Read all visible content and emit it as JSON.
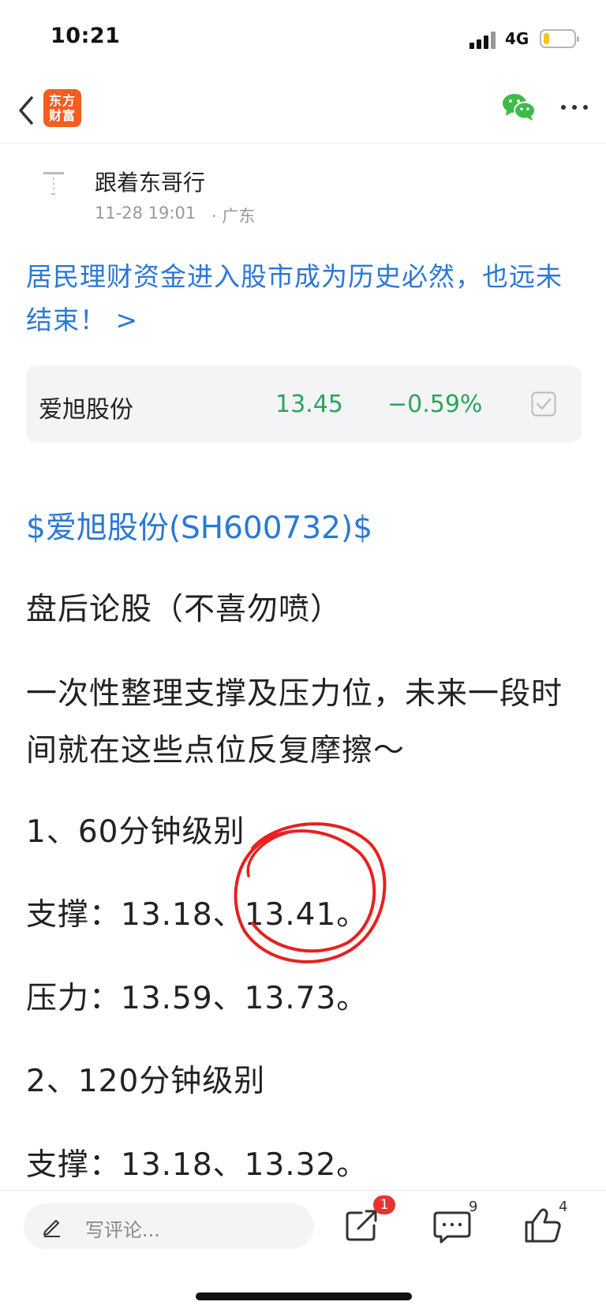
{
  "status_bar": {
    "time": "10:21",
    "network": "4G",
    "battery_level": 0.2,
    "battery_color": "#f5c518"
  },
  "nav": {
    "logo_line1": "东方",
    "logo_line2": "财富",
    "logo_color": "#f35d1e",
    "icons": [
      "back-icon",
      "wechat-icon",
      "more-icon"
    ]
  },
  "author": {
    "name": "跟着东哥行",
    "time": "11-28 19:01",
    "location": "· 广东"
  },
  "topic": {
    "text": "居民理财资金进入股市成为历史必然，也远未结束！ >",
    "color": "#2b78d6"
  },
  "stock_card": {
    "name": "爱旭股份",
    "price": "13.45",
    "change": "−0.59%",
    "color": "#2aa55a"
  },
  "article": {
    "stock_tag": "$爱旭股份(SH600732)$",
    "paragraphs": [
      "盘后论股（不喜勿喷）",
      "一次性整理支撑及压力位，未来一段时间就在这些点位反复摩擦～",
      "1、60分钟级别",
      "支撑：13.18、13.41。",
      "压力：13.59、13.73。",
      "2、120分钟级别",
      "支撑：13.18、13.32。"
    ]
  },
  "bottom_bar": {
    "comment_placeholder": "写评论...",
    "share_badge": "1",
    "comment_count": "9",
    "like_count": "4",
    "badge_color": "#e8322f"
  }
}
